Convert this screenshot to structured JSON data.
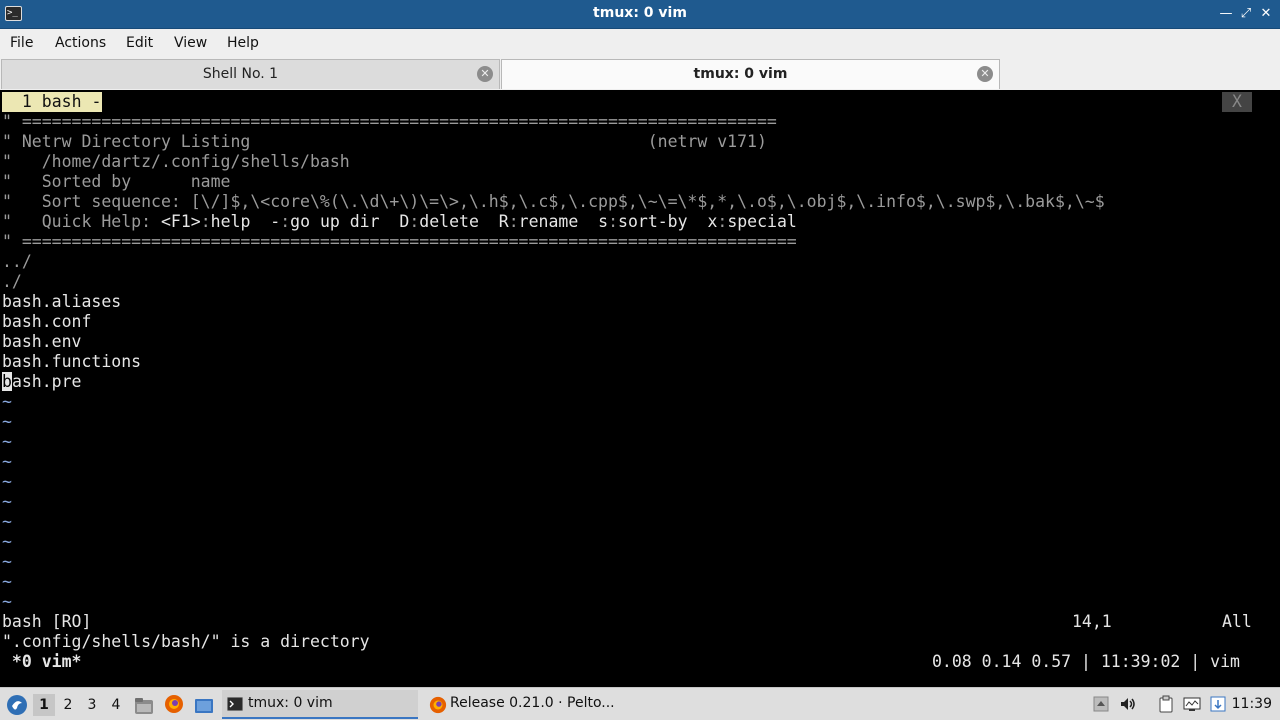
{
  "window": {
    "title": "tmux: 0 vim",
    "controls": [
      "minimize",
      "maximize",
      "close"
    ]
  },
  "menu": [
    "File",
    "Actions",
    "Edit",
    "View",
    "Help"
  ],
  "tabs": [
    {
      "label": "Shell No. 1",
      "active": false
    },
    {
      "label": "tmux: 0 vim",
      "active": true
    }
  ],
  "vim": {
    "tabline_label": " 1 bash - ",
    "tabline_close": "X",
    "header": [
      "\" ============================================================================",
      "\" Netrw Directory Listing                                        (netrw v171)",
      "\"   /home/dartz/.config/shells/bash",
      "\"   Sorted by      name",
      "\"   Sort sequence: [\\/]$,\\<core\\%(\\.\\d\\+\\)\\=\\>,\\.h$,\\.c$,\\.cpp$,\\~\\=\\*$,*,\\.o$,\\.obj$,\\.info$,\\.swp$,\\.bak$,\\~$"
    ],
    "quick_help": {
      "prefix": "\"   Quick Help: ",
      "items": [
        {
          "key": "<F1>",
          "sep": ":",
          "action": "help"
        },
        {
          "key": "-",
          "sep": ":",
          "action": "go up dir"
        },
        {
          "key": "D",
          "sep": ":",
          "action": "delete"
        },
        {
          "key": "R",
          "sep": ":",
          "action": "rename"
        },
        {
          "key": "s",
          "sep": ":",
          "action": "sort-by"
        },
        {
          "key": "x",
          "sep": ":",
          "action": "special"
        }
      ]
    },
    "separator_bottom": "\" ==============================================================================",
    "dirs": [
      "../",
      "./"
    ],
    "files": [
      "bash.aliases",
      "bash.conf",
      "bash.env",
      "bash.functions",
      "bash.pre"
    ],
    "tildes": [
      "~",
      "~",
      "~",
      "~",
      "~",
      "~",
      "~",
      "~",
      "~",
      "~",
      "~"
    ],
    "statusline": {
      "left": "bash [RO]",
      "position": "14,1",
      "scroll": "All"
    },
    "message": "\".config/shells/bash/\" is a directory"
  },
  "tmux": {
    "left": " *0 vim*",
    "right": "0.08 0.14 0.57 | 11:39:02 | vim"
  },
  "taskbar": {
    "workspaces": [
      "1",
      "2",
      "3",
      "4"
    ],
    "active_workspace": "1",
    "tasks": [
      {
        "label": "tmux: 0 vim",
        "active": true,
        "icon": "terminal-icon"
      },
      {
        "label": "Release 0.21.0 · Pelto...",
        "active": false,
        "icon": "firefox-icon"
      }
    ],
    "clock": "11:39"
  },
  "colors": {
    "titlebar": "#1f5a8f",
    "tabline_tab_bg": "#ece7b3",
    "taskbar_active_underline": "#3a76c2"
  }
}
